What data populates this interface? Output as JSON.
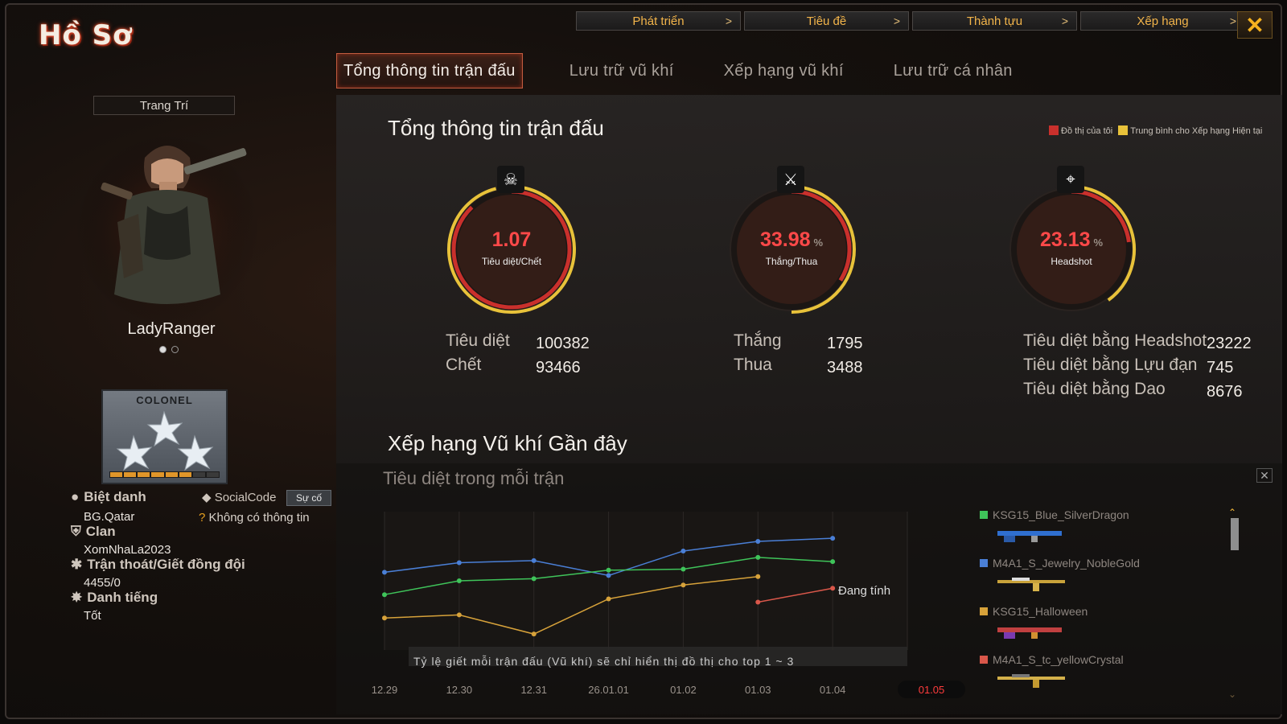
{
  "window": {
    "title": "Hồ Sơ",
    "close_icon": "close-icon"
  },
  "top_nav": [
    {
      "label": "Phát triển"
    },
    {
      "label": "Tiêu đề"
    },
    {
      "label": "Thành tựu"
    },
    {
      "label": "Xếp hạng"
    }
  ],
  "tabs": [
    {
      "label": "Tổng thông tin trận đấu",
      "active": true
    },
    {
      "label": "Lưu trữ vũ khí"
    },
    {
      "label": "Xếp hạng vũ khí"
    },
    {
      "label": "Lưu trữ cá nhân"
    }
  ],
  "profile": {
    "deco_label": "Trang Trí",
    "name": "LadyRanger",
    "rank": "COLONEL",
    "rank_progress": 0.8,
    "nickname_label": "Biệt danh",
    "nickname": "BG.Qatar",
    "social_label": "SocialCode",
    "report_label": "Sự cố",
    "social_value": "Không có thông tin",
    "clan_label": "Clan",
    "clan": "XomNhaLa2023",
    "quit_label": "Trận thoát/Giết đồng đội",
    "quit_value": "4455/0",
    "rep_label": "Danh tiếng",
    "rep_value": "Tốt"
  },
  "stats": {
    "title": "Tổng thông tin trận đấu",
    "legend_mine": "Đồ thị của tôi",
    "legend_avg": "Trung bình cho Xếp hạng Hiện tại",
    "gauges": [
      {
        "value": "1.07",
        "unit": "",
        "label": "Tiêu diệt/Chết",
        "fill": 0.88,
        "avg": 0.96
      },
      {
        "value": "33.98",
        "unit": "%",
        "label": "Thắng/Thua",
        "fill": 0.34,
        "avg": 0.5
      },
      {
        "value": "23.13",
        "unit": "%",
        "label": "Headshot",
        "fill": 0.23,
        "avg": 0.4
      }
    ],
    "kills_label": "Tiêu diệt",
    "kills": "100382",
    "deaths_label": "Chết",
    "deaths": "93466",
    "wins_label": "Thắng",
    "wins": "1795",
    "losses_label": "Thua",
    "losses": "3488",
    "hs_label": "Tiêu diệt bằng Headshot",
    "hs": "23222",
    "grenade_label": "Tiêu diệt bằng Lựu đạn",
    "grenade": "745",
    "knife_label": "Tiêu diệt bằng Dao",
    "knife": "8676"
  },
  "recent": {
    "title": "Xếp hạng Vũ khí Gần đây",
    "subtitle": "Tiêu diệt trong mỗi trận",
    "calculating": "Đang tính",
    "note": "Tỷ lệ giết mỗi trận đấu (Vũ khí) sẽ chỉ hiển thị đồ thị cho top 1 ~ 3",
    "weapons": [
      {
        "name": "KSG15_Blue_SilverDragon",
        "color": "#3fc45a"
      },
      {
        "name": "M4A1_S_Jewelry_NobleGold",
        "color": "#4a7fd6"
      },
      {
        "name": "KSG15_Halloween",
        "color": "#d7a23a"
      },
      {
        "name": "M4A1_S_tc_yellowCrystal",
        "color": "#d9574a"
      }
    ]
  },
  "chart_data": {
    "type": "line",
    "categories": [
      "12.29",
      "12.30",
      "12.31",
      "26.01.01",
      "01.02",
      "01.03",
      "01.04",
      "01.05"
    ],
    "selected_category": "01.05",
    "series": [
      {
        "name": "KSG15_Blue_SilverDragon",
        "color": "#4a7fd6",
        "values": [
          0.73,
          0.82,
          0.84,
          0.7,
          0.93,
          1.02,
          1.05,
          null
        ]
      },
      {
        "name": "M4A1_S_Jewelry_NobleGold",
        "color": "#3fc45a",
        "values": [
          0.52,
          0.65,
          0.67,
          0.75,
          0.76,
          0.87,
          0.83,
          null
        ]
      },
      {
        "name": "KSG15_Halloween",
        "color": "#d7a23a",
        "values": [
          0.3,
          0.33,
          0.15,
          0.48,
          0.61,
          0.69,
          null,
          null
        ]
      },
      {
        "name": "M4A1_S_tc_yellowCrystal",
        "color": "#d9574a",
        "values": [
          null,
          null,
          null,
          null,
          null,
          0.45,
          0.58,
          null
        ]
      }
    ],
    "ylim": [
      0,
      1.3
    ],
    "grid": true
  }
}
